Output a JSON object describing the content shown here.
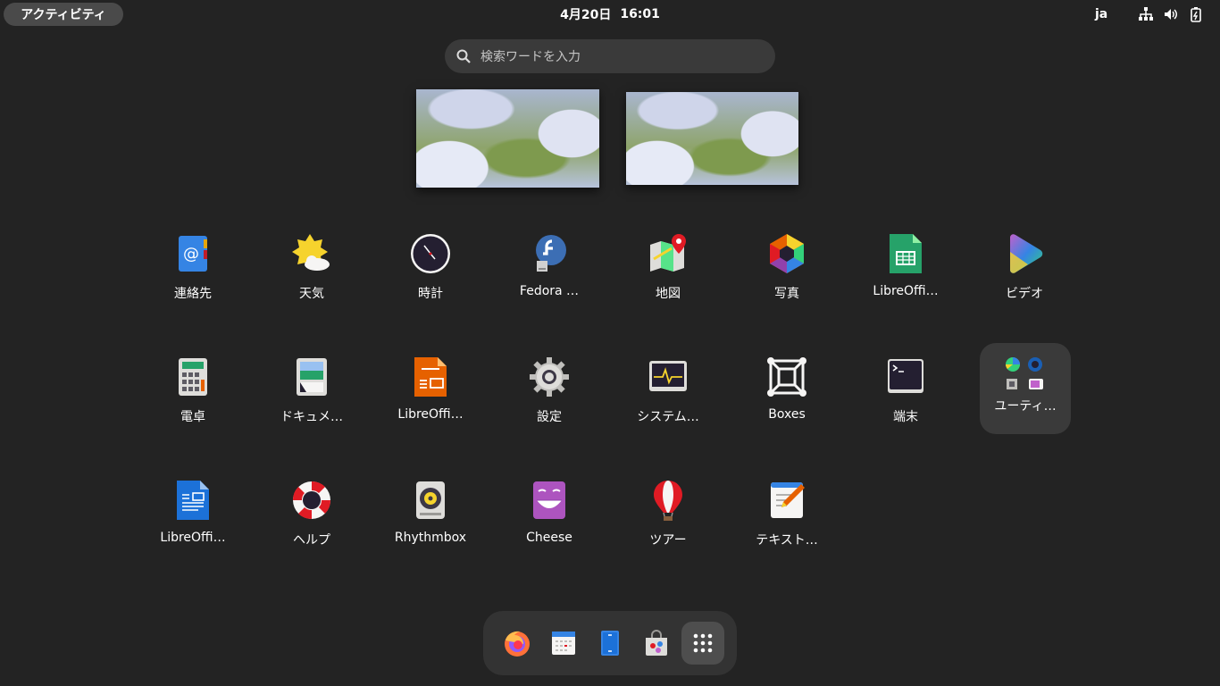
{
  "topbar": {
    "activities_label": "アクティビティ",
    "date": "4月20日",
    "time": "16:01",
    "input_method": "ja",
    "tray_icons": [
      "network-icon",
      "volume-icon",
      "battery-icon"
    ]
  },
  "search": {
    "placeholder": "検索ワードを入力"
  },
  "workspaces": [
    {
      "label": "workspace-1"
    },
    {
      "label": "workspace-2"
    }
  ],
  "apps": [
    {
      "label": "連絡先",
      "icon": "contacts-icon"
    },
    {
      "label": "天気",
      "icon": "weather-icon"
    },
    {
      "label": "時計",
      "icon": "clock-icon"
    },
    {
      "label": "Fedora …",
      "icon": "fedora-icon"
    },
    {
      "label": "地図",
      "icon": "maps-icon"
    },
    {
      "label": "写真",
      "icon": "photos-icon"
    },
    {
      "label": "LibreOffi…",
      "icon": "libreoffice-calc-icon"
    },
    {
      "label": "ビデオ",
      "icon": "videos-icon"
    },
    {
      "label": "電卓",
      "icon": "calculator-icon"
    },
    {
      "label": "ドキュメ…",
      "icon": "document-scanner-icon"
    },
    {
      "label": "LibreOffi…",
      "icon": "libreoffice-impress-icon"
    },
    {
      "label": "設定",
      "icon": "settings-icon"
    },
    {
      "label": "システム…",
      "icon": "system-monitor-icon"
    },
    {
      "label": "Boxes",
      "icon": "boxes-icon"
    },
    {
      "label": "端末",
      "icon": "terminal-icon"
    },
    {
      "label": "ユーティ…",
      "icon": "utilities-folder-icon"
    },
    {
      "label": "LibreOffi…",
      "icon": "libreoffice-writer-icon"
    },
    {
      "label": "ヘルプ",
      "icon": "help-icon"
    },
    {
      "label": "Rhythmbox",
      "icon": "rhythmbox-icon"
    },
    {
      "label": "Cheese",
      "icon": "cheese-icon"
    },
    {
      "label": "ツアー",
      "icon": "tour-icon"
    },
    {
      "label": "テキスト…",
      "icon": "text-editor-icon"
    }
  ],
  "dash": [
    "firefox-icon",
    "calendar-icon",
    "files-icon",
    "software-icon",
    "show-apps-icon"
  ],
  "colors": {
    "background": "#232323",
    "panel": "#333333",
    "search_bg": "#3a3a3a",
    "accent_blue": "#3584e4"
  }
}
